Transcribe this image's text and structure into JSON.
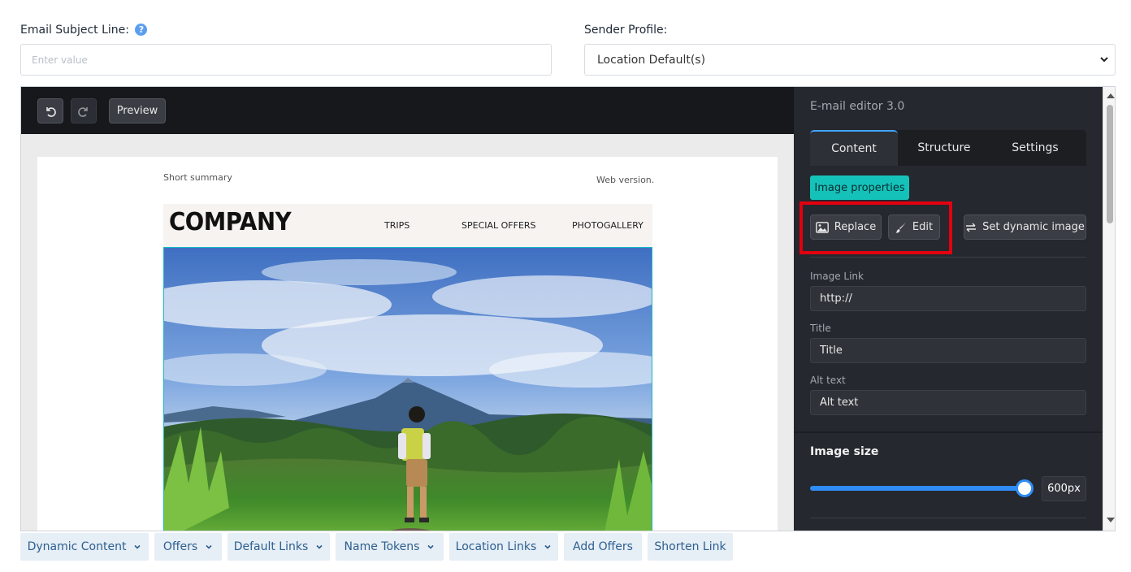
{
  "form": {
    "subject_label": "Email Subject Line:",
    "subject_placeholder": "Enter value",
    "sender_label": "Sender Profile:",
    "sender_value": "Location Default(s)"
  },
  "toolbar": {
    "preview_label": "Preview"
  },
  "email_preview": {
    "summary": "Short summary",
    "web_version": "Web version.",
    "logo": "COMPANY",
    "nav": [
      "TRIPS",
      "SPECIAL OFFERS",
      "PHOTOGALLERY"
    ]
  },
  "panel": {
    "title": "E-mail editor 3.0",
    "tabs": [
      "Content",
      "Structure",
      "Settings"
    ],
    "active_tab": "Content",
    "image_properties": "Image properties",
    "replace_label": "Replace",
    "edit_label": "Edit",
    "dynamic_label": "Set dynamic image",
    "image_link_label": "Image Link",
    "image_link_value": "http://",
    "title_label": "Title",
    "title_value": "Title",
    "alt_label": "Alt text",
    "alt_value": "Alt text",
    "size_title": "Image size",
    "size_value": "600px",
    "size_fraction": 1.0
  },
  "bottom_buttons": [
    {
      "label": "Dynamic Content",
      "dropdown": true
    },
    {
      "label": "Offers",
      "dropdown": true
    },
    {
      "label": "Default Links",
      "dropdown": true
    },
    {
      "label": "Name Tokens",
      "dropdown": true
    },
    {
      "label": "Location Links",
      "dropdown": true
    },
    {
      "label": "Add Offers",
      "dropdown": false
    },
    {
      "label": "Shorten Link",
      "dropdown": false
    }
  ],
  "colors": {
    "accent_teal": "#14c2b9",
    "highlight_red": "#e3000f",
    "slider_blue": "#2f8cf5",
    "panel_dark": "#25282e"
  }
}
